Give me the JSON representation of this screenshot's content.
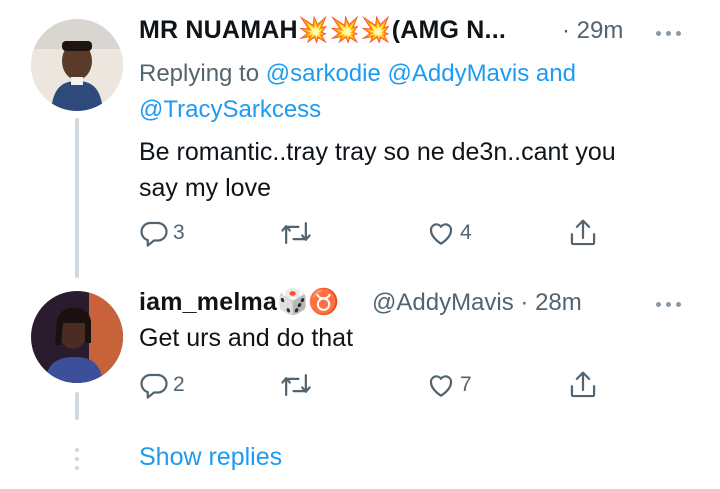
{
  "tweet1": {
    "display_name": "MR NUAMAH💥💥💥(AMG N...",
    "time": "· 29m",
    "reply_prefix": "Replying to",
    "mention1": "@sarkodie",
    "mention2": "@AddyMavis",
    "reply_and": "and",
    "mention3": "@TracySarkcess",
    "text_line1": "Be romantic..tray tray  so ne de3n..cant you",
    "text_line2": "say my love",
    "reply_count": "3",
    "retweet_count": "",
    "like_count": "4"
  },
  "tweet2": {
    "display_name": "iam_melma🎲♉",
    "handle_time": "@AddyMavis · 28m",
    "text": "Get urs and do that",
    "reply_count": "2",
    "retweet_count": "",
    "like_count": "7"
  },
  "show_replies": "Show replies",
  "colors": {
    "accent": "#1d9bf0",
    "muted": "#536471",
    "line": "#cfd9de"
  }
}
